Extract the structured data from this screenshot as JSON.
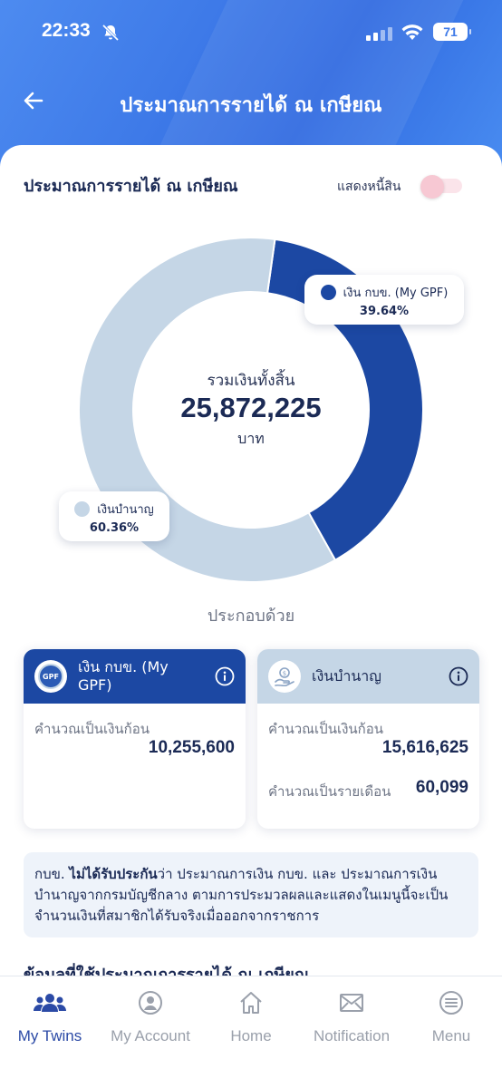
{
  "status_bar": {
    "time": "22:33",
    "battery": "71"
  },
  "header": {
    "title": "ประมาณการรายได้ ณ เกษียณ"
  },
  "section": {
    "title": "ประมาณการรายได้ ณ เกษียณ",
    "toggle_label": "แสดงหนี้สิน",
    "toggle_on": false
  },
  "donut": {
    "total_label": "รวมเงินทั้งสิ้น",
    "total_value": "25,872,225",
    "unit": "บาท",
    "segments": [
      {
        "name": "เงิน กบข. (My GPF)",
        "percent": 39.64,
        "percent_text": "39.64%",
        "color": "#1c48a3"
      },
      {
        "name": "เงินบำนาญ",
        "percent": 60.36,
        "percent_text": "60.36%",
        "color": "#c5d6e6"
      }
    ]
  },
  "consist_label": "ประกอบด้วย",
  "boxes": {
    "gpf": {
      "logo_text": "GPF",
      "title": "เงิน กบข. (My GPF)",
      "lump_label": "คำนวณเป็นเงินก้อน",
      "lump_value": "10,255,600"
    },
    "pension": {
      "title": "เงินบำนาญ",
      "lump_label": "คำนวณเป็นเงินก้อน",
      "lump_value": "15,616,625",
      "monthly_label": "คำนวณเป็นรายเดือน",
      "monthly_value": "60,099"
    }
  },
  "notice": {
    "prefix": "กบข. ",
    "bold": "ไม่ได้รับประกัน",
    "rest": "ว่า ประมาณการเงิน กบข. และ ประมาณการเงินบำนาญจากกรมบัญชีกลาง ตามการประมวลผลและแสดงในเมนูนี้จะเป็นจำนวนเงินที่สมาชิกได้รับจริงเมื่อออกจากราชการ"
  },
  "next_section_peek": "ข้อมูลที่ใช้ประมาณการรายได้ ณ เกษียณ",
  "tabbar": [
    {
      "label": "My Twins",
      "icon": "people-icon",
      "active": true
    },
    {
      "label": "My Account",
      "icon": "person-icon",
      "active": false
    },
    {
      "label": "Home",
      "icon": "home-icon",
      "active": false
    },
    {
      "label": "Notification",
      "icon": "envelope-icon",
      "active": false
    },
    {
      "label": "Menu",
      "icon": "menu-icon",
      "active": false
    }
  ],
  "colors": {
    "primary": "#1c48a3",
    "secondary": "#c5d6e6",
    "header": "#3e7ae8",
    "toggle_off": "#f7c8d3",
    "active_tab": "#2b4aa6"
  }
}
